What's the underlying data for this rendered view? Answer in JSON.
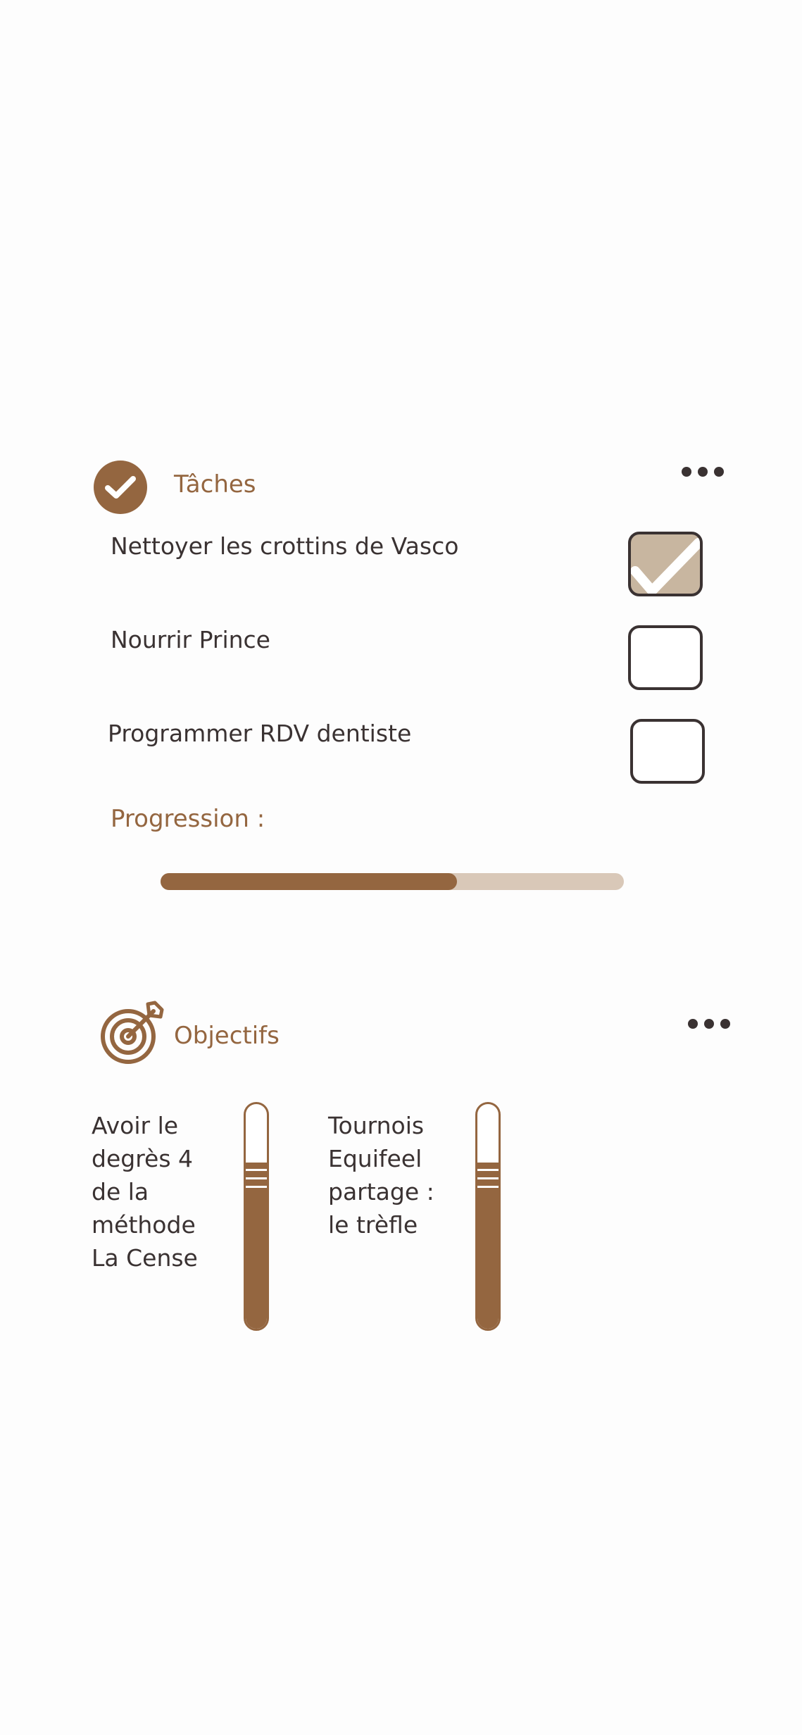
{
  "colors": {
    "accent": "#946640",
    "text": "#3a3232",
    "checked_fill": "#c8b6a0",
    "track": "#d9c8b8"
  },
  "tasks": {
    "title": "Tâches",
    "icon": "check-circle-icon",
    "menu_icon": "more-horizontal-icon",
    "items": [
      {
        "label": "Nettoyer les crottins de Vasco",
        "checked": true
      },
      {
        "label": "Nourrir Prince",
        "checked": false
      },
      {
        "label": "Programmer RDV dentiste",
        "checked": false
      }
    ],
    "progress_label": "Progression :",
    "progress_fraction": 0.64
  },
  "goals": {
    "title": "Objectifs",
    "icon": "target-arrow-icon",
    "menu_icon": "more-horizontal-icon",
    "items": [
      {
        "lines": [
          "Avoir le",
          "degrès 4",
          "de la",
          "méthode",
          "La Cense"
        ],
        "level_fraction": 0.75
      },
      {
        "lines": [
          "Tournois",
          "Equifeel",
          "partage :",
          "le trèfle"
        ],
        "level_fraction": 0.75
      }
    ]
  }
}
